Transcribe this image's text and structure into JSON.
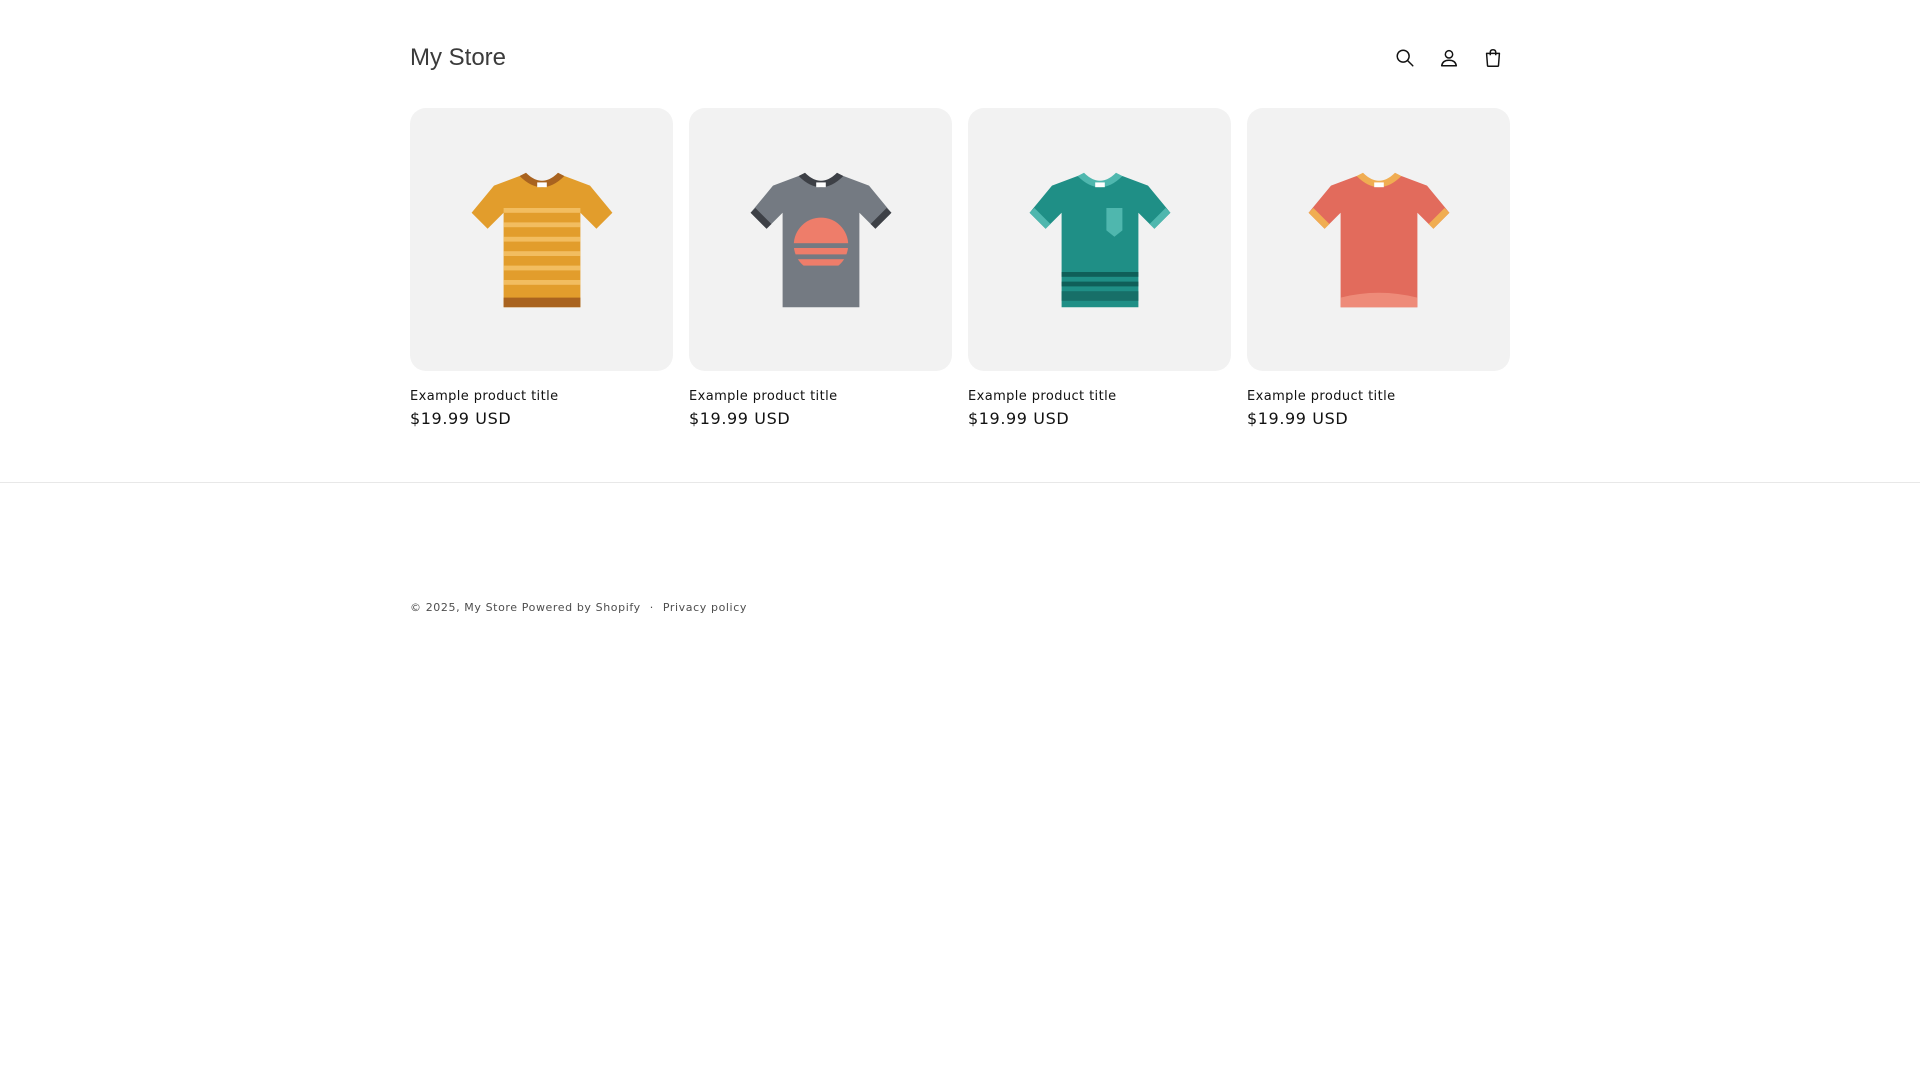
{
  "header": {
    "store_name": "My Store",
    "icons": [
      "search-icon",
      "account-icon",
      "cart-icon"
    ]
  },
  "products": [
    {
      "title": "Example product title",
      "price": "$19.99 USD",
      "image": "orange-striped-tshirt",
      "color": "#e29d2c"
    },
    {
      "title": "Example product title",
      "price": "$19.99 USD",
      "image": "gray-sunset-tshirt",
      "color": "#747a82"
    },
    {
      "title": "Example product title",
      "price": "$19.99 USD",
      "image": "teal-pocket-tshirt",
      "color": "#1f8f86"
    },
    {
      "title": "Example product title",
      "price": "$19.99 USD",
      "image": "coral-ringer-tshirt",
      "color": "#e26b5c"
    }
  ],
  "footer": {
    "copyright_prefix": "© 2025,",
    "store_link": "My Store",
    "powered_by": "Powered by Shopify",
    "separator": "·",
    "privacy_policy": "Privacy policy"
  },
  "colors": {
    "card_background": "#f2f2f2",
    "text": "#121212",
    "divider": "#e8e8e8"
  }
}
